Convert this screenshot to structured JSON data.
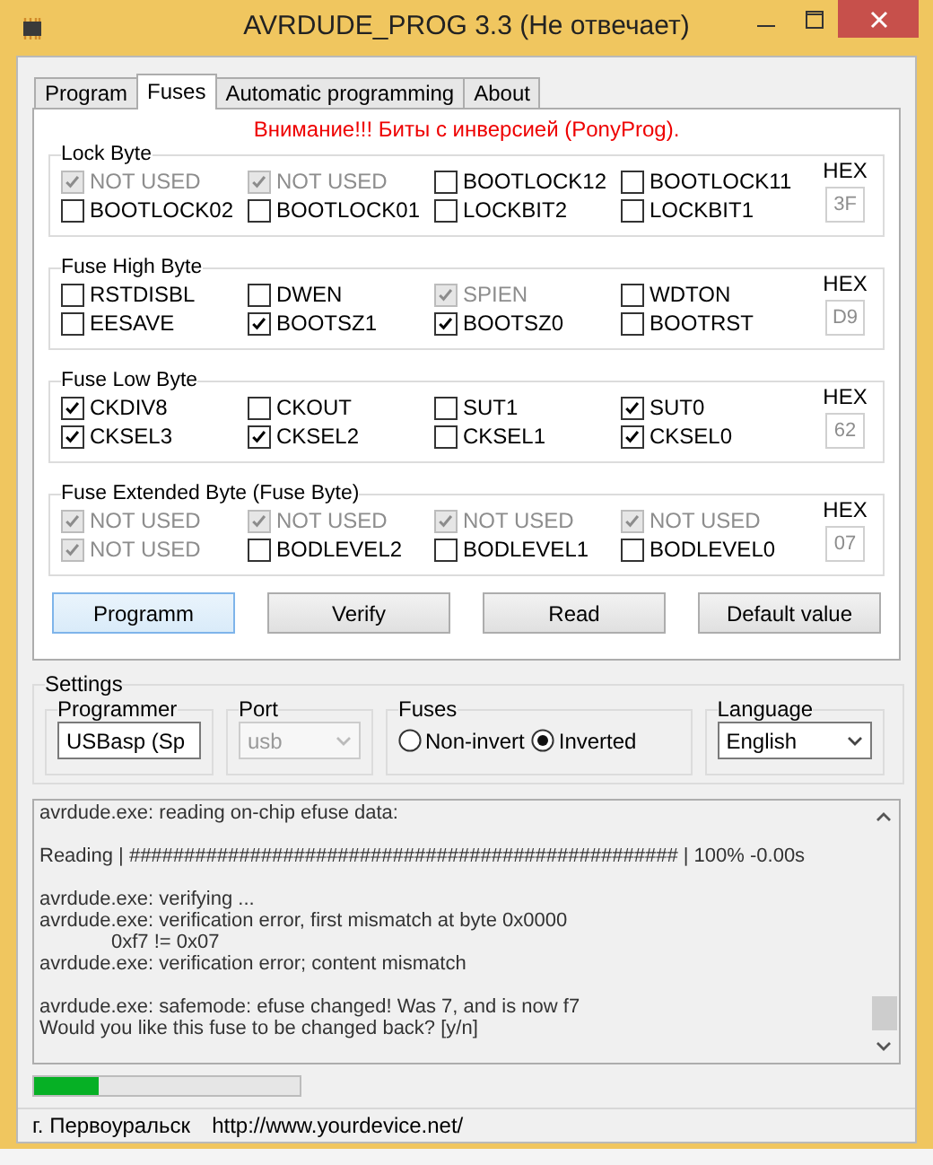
{
  "window": {
    "title": "AVRDUDE_PROG 3.3 (Не отвечает)"
  },
  "tabs": [
    {
      "label": "Program",
      "selected": false
    },
    {
      "label": "Fuses",
      "selected": true
    },
    {
      "label": "Automatic programming",
      "selected": false
    },
    {
      "label": "About",
      "selected": false
    }
  ],
  "warning": "Внимание!!! Биты с инверсией (PonyProg).",
  "groups": [
    {
      "title": "Lock Byte",
      "hex_label": "HEX",
      "hex": "3F",
      "bits": [
        {
          "label": "NOT USED",
          "checked": true,
          "disabled": true
        },
        {
          "label": "NOT USED",
          "checked": true,
          "disabled": true
        },
        {
          "label": "BOOTLOCK12",
          "checked": false,
          "disabled": false
        },
        {
          "label": "BOOTLOCK11",
          "checked": false,
          "disabled": false
        },
        {
          "label": "BOOTLOCK02",
          "checked": false,
          "disabled": false
        },
        {
          "label": "BOOTLOCK01",
          "checked": false,
          "disabled": false
        },
        {
          "label": "LOCKBIT2",
          "checked": false,
          "disabled": false
        },
        {
          "label": "LOCKBIT1",
          "checked": false,
          "disabled": false
        }
      ]
    },
    {
      "title": "Fuse High Byte",
      "hex_label": "HEX",
      "hex": "D9",
      "bits": [
        {
          "label": "RSTDISBL",
          "checked": false,
          "disabled": false
        },
        {
          "label": "DWEN",
          "checked": false,
          "disabled": false
        },
        {
          "label": "SPIEN",
          "checked": true,
          "disabled": true
        },
        {
          "label": "WDTON",
          "checked": false,
          "disabled": false
        },
        {
          "label": "EESAVE",
          "checked": false,
          "disabled": false
        },
        {
          "label": "BOOTSZ1",
          "checked": true,
          "disabled": false
        },
        {
          "label": "BOOTSZ0",
          "checked": true,
          "disabled": false
        },
        {
          "label": "BOOTRST",
          "checked": false,
          "disabled": false
        }
      ]
    },
    {
      "title": "Fuse Low Byte",
      "hex_label": "HEX",
      "hex": "62",
      "bits": [
        {
          "label": "CKDIV8",
          "checked": true,
          "disabled": false
        },
        {
          "label": "CKOUT",
          "checked": false,
          "disabled": false
        },
        {
          "label": "SUT1",
          "checked": false,
          "disabled": false
        },
        {
          "label": "SUT0",
          "checked": true,
          "disabled": false
        },
        {
          "label": "CKSEL3",
          "checked": true,
          "disabled": false
        },
        {
          "label": "CKSEL2",
          "checked": true,
          "disabled": false
        },
        {
          "label": "CKSEL1",
          "checked": false,
          "disabled": false
        },
        {
          "label": "CKSEL0",
          "checked": true,
          "disabled": false
        }
      ]
    },
    {
      "title": "Fuse Extended Byte (Fuse Byte)",
      "hex_label": "HEX",
      "hex": "07",
      "bits": [
        {
          "label": "NOT USED",
          "checked": true,
          "disabled": true
        },
        {
          "label": "NOT USED",
          "checked": true,
          "disabled": true
        },
        {
          "label": "NOT USED",
          "checked": true,
          "disabled": true
        },
        {
          "label": "NOT USED",
          "checked": true,
          "disabled": true
        },
        {
          "label": "NOT USED",
          "checked": true,
          "disabled": true
        },
        {
          "label": "BODLEVEL2",
          "checked": false,
          "disabled": false
        },
        {
          "label": "BODLEVEL1",
          "checked": false,
          "disabled": false
        },
        {
          "label": "BODLEVEL0",
          "checked": false,
          "disabled": false
        }
      ]
    }
  ],
  "buttons": [
    {
      "label": "Programm",
      "selected": true
    },
    {
      "label": "Verify",
      "selected": false
    },
    {
      "label": "Read",
      "selected": false
    },
    {
      "label": "Default value",
      "selected": false
    }
  ],
  "settings": {
    "title": "Settings",
    "programmer": {
      "label": "Programmer",
      "value": "USBasp (Sp",
      "disabled": false
    },
    "port": {
      "label": "Port",
      "value": "usb",
      "disabled": true
    },
    "fuses": {
      "label": "Fuses",
      "options": [
        {
          "label": "Non-invert",
          "selected": false
        },
        {
          "label": "Inverted",
          "selected": true
        }
      ]
    },
    "language": {
      "label": "Language",
      "value": "English",
      "disabled": false
    }
  },
  "log": {
    "paragraphs": [
      {
        "lines": [
          {
            "text": "avrdude.exe: reading on-chip efuse data:",
            "kind": "plain"
          }
        ]
      },
      {
        "lines": [
          {
            "text": "Reading | ################################################## | 100% -0.00s",
            "kind": "plain"
          }
        ]
      },
      {
        "lines": [
          {
            "text": "avrdude.exe: verifying ...",
            "kind": "plain"
          },
          {
            "text": "avrdude.exe: verification error, first mismatch at byte 0x0000",
            "kind": "plain"
          },
          {
            "text": "0xf7 != 0x07",
            "kind": "indented"
          },
          {
            "text": "avrdude.exe: verification error; content mismatch",
            "kind": "plain"
          }
        ]
      },
      {
        "lines": [
          {
            "text": "avrdude.exe: safemode: efuse changed! Was 7, and is now f7",
            "kind": "plain"
          },
          {
            "text": "Would you like this fuse to be changed back? [y/n]",
            "kind": "plain"
          }
        ]
      }
    ]
  },
  "progress": {
    "level": 0.24
  },
  "status_bar": {
    "city": "г. Первоуральск",
    "url": "http://www.yourdevice.net/"
  }
}
